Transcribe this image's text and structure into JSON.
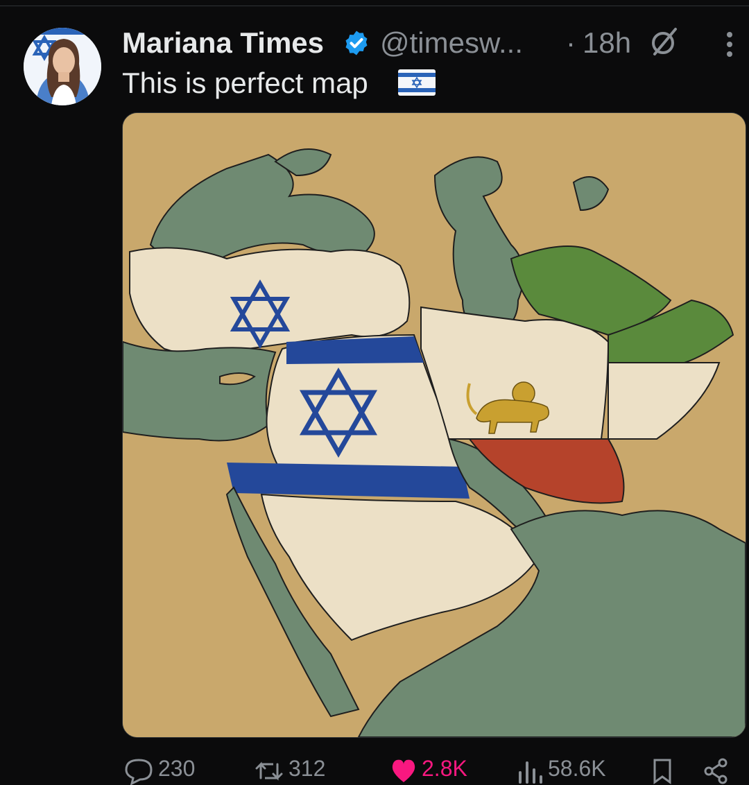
{
  "tweet": {
    "author_name": "Mariana Times",
    "handle": "@timesw...",
    "separator": "·",
    "time": "18h",
    "text": "This is perfect map",
    "flag_emoji": "israel-flag"
  },
  "actions": {
    "replies": "230",
    "reposts": "312",
    "likes": "2.8K",
    "views": "58.6K"
  },
  "colors": {
    "background": "#0b0b0c",
    "verified_blue": "#1d9bf0",
    "like_pink": "#f91880",
    "muted": "#8b9096",
    "map_land": "#c9a86c",
    "map_water": "#6f8a72",
    "israel_blue": "#24489a",
    "iran_green": "#5a8a3c",
    "iran_red": "#b5432b"
  }
}
